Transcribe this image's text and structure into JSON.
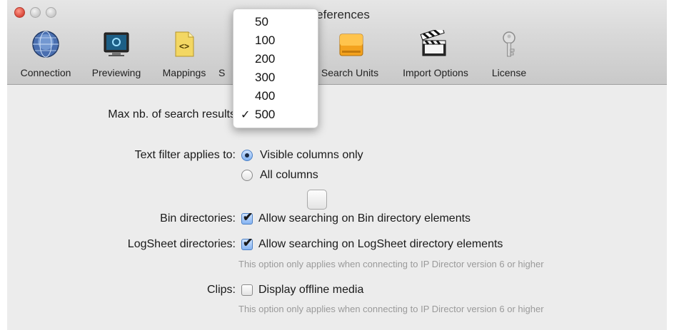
{
  "window": {
    "title": "Preferences"
  },
  "toolbar": {
    "items": [
      {
        "label": "Connection",
        "icon": "globe-icon"
      },
      {
        "label": "Previewing",
        "icon": "monitor-icon"
      },
      {
        "label": "Mappings",
        "icon": "mapping-document-icon"
      },
      {
        "label": "S",
        "icon": "search-icon"
      },
      {
        "label": "Search Units",
        "icon": "drive-icon"
      },
      {
        "label": "Import Options",
        "icon": "clapperboard-icon"
      },
      {
        "label": "License",
        "icon": "key-icon"
      }
    ]
  },
  "search": {
    "max_results_label": "Max nb. of search results",
    "menu_options": [
      "50",
      "100",
      "200",
      "300",
      "400",
      "500"
    ],
    "selected": "500",
    "check_glyph": "✓"
  },
  "text_filter": {
    "label": "Text filter applies to:",
    "options": [
      "Visible columns only",
      "All columns"
    ],
    "selected_index": 0
  },
  "bin": {
    "label": "Bin directories:",
    "option": "Allow searching on Bin directory elements",
    "checked": true
  },
  "logsheet": {
    "label": "LogSheet directories:",
    "option": "Allow searching on LogSheet directory elements",
    "checked": true,
    "note": "This option only applies when connecting to IP Director version 6 or higher"
  },
  "clips": {
    "label": "Clips:",
    "option": "Display offline media",
    "checked": false,
    "note": "This option only applies when connecting to IP Director version 6 or higher"
  },
  "check_glyph": "✔",
  "colors": {
    "accent": "#4b7fc4",
    "menu_bg": "#ffffff",
    "panel_bg": "#ececec"
  }
}
